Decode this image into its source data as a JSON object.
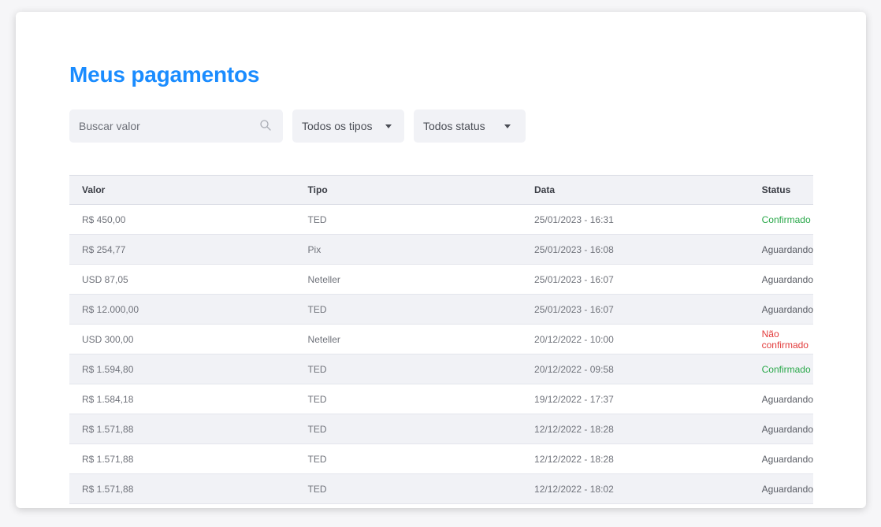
{
  "page": {
    "title": "Meus pagamentos"
  },
  "filters": {
    "search_placeholder": "Buscar valor",
    "type_select": "Todos os tipos",
    "status_select": "Todos status"
  },
  "table": {
    "headers": [
      "Valor",
      "Tipo",
      "Data",
      "Status"
    ],
    "rows": [
      {
        "valor": "R$ 450,00",
        "tipo": "TED",
        "data": "25/01/2023 - 16:31",
        "status": "Confirmado"
      },
      {
        "valor": "R$ 254,77",
        "tipo": "Pix",
        "data": "25/01/2023 - 16:08",
        "status": "Aguardando"
      },
      {
        "valor": "USD 87,05",
        "tipo": "Neteller",
        "data": "25/01/2023 - 16:07",
        "status": "Aguardando"
      },
      {
        "valor": "R$ 12.000,00",
        "tipo": "TED",
        "data": "25/01/2023 - 16:07",
        "status": "Aguardando"
      },
      {
        "valor": "USD 300,00",
        "tipo": "Neteller",
        "data": "20/12/2022 - 10:00",
        "status": "Não confirmado"
      },
      {
        "valor": "R$ 1.594,80",
        "tipo": "TED",
        "data": "20/12/2022 - 09:58",
        "status": "Confirmado"
      },
      {
        "valor": "R$ 1.584,18",
        "tipo": "TED",
        "data": "19/12/2022 - 17:37",
        "status": "Aguardando"
      },
      {
        "valor": "R$ 1.571,88",
        "tipo": "TED",
        "data": "12/12/2022 - 18:28",
        "status": "Aguardando"
      },
      {
        "valor": "R$ 1.571,88",
        "tipo": "TED",
        "data": "12/12/2022 - 18:28",
        "status": "Aguardando"
      },
      {
        "valor": "R$ 1.571,88",
        "tipo": "TED",
        "data": "12/12/2022 - 18:02",
        "status": "Aguardando"
      }
    ]
  },
  "colors": {
    "accent": "#1a8cff",
    "confirmed": "#2aa84a",
    "not_confirmed": "#e23b3b",
    "pending": "#5a5d65"
  },
  "icons": {
    "search": "search-icon",
    "dropdown": "chevron-down-icon"
  }
}
